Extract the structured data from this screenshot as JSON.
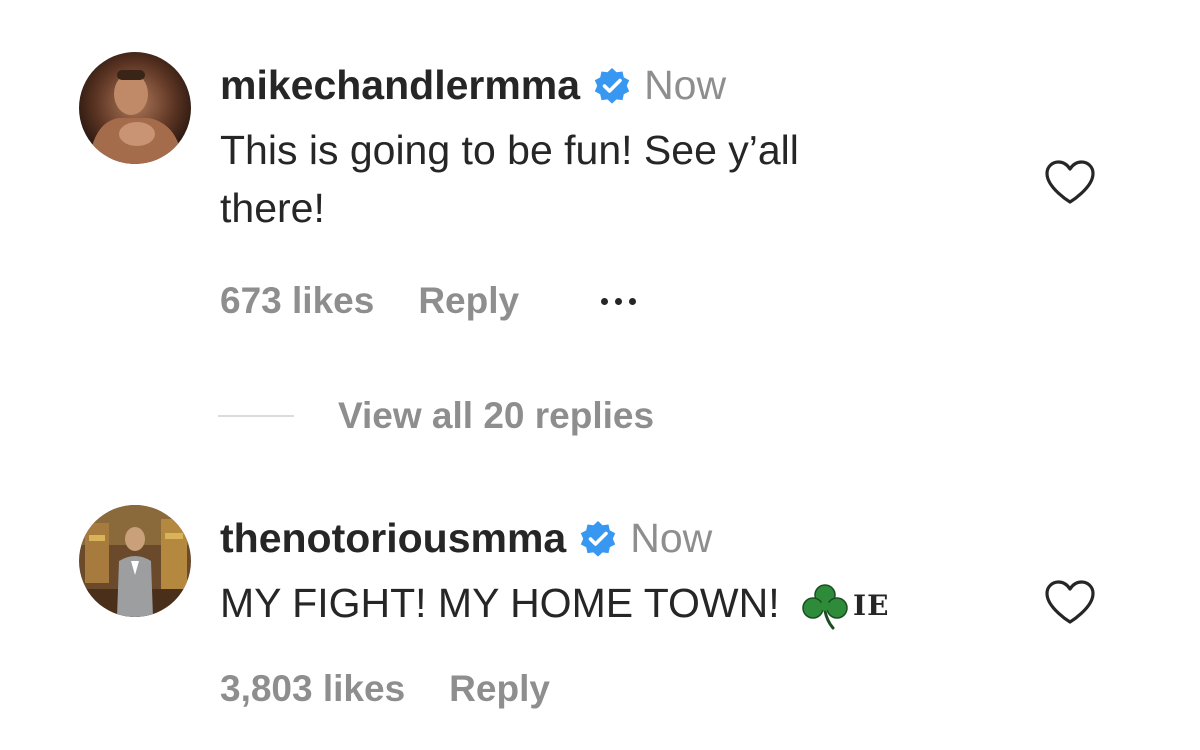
{
  "comments": [
    {
      "username": "mikechandlermma",
      "verified": true,
      "time": "Now",
      "text_line1": "This is going to be fun! See y’all",
      "text_line2": "there!",
      "likes": "673 likes",
      "reply_label": "Reply",
      "more_icon": "more-options-icon",
      "view_replies": "View all 20 replies"
    },
    {
      "username": "thenotoriousmma",
      "verified": true,
      "time": "Now",
      "text": "MY FIGHT! MY HOME TOWN!",
      "emoji": "☘",
      "flag_text": "IE",
      "likes": "3,803 likes",
      "reply_label": "Reply"
    }
  ],
  "colors": {
    "verified_blue": "#3897f0",
    "muted_text": "#8e8e8e",
    "primary_text": "#262626",
    "shamrock_green": "#2e8b3a"
  }
}
